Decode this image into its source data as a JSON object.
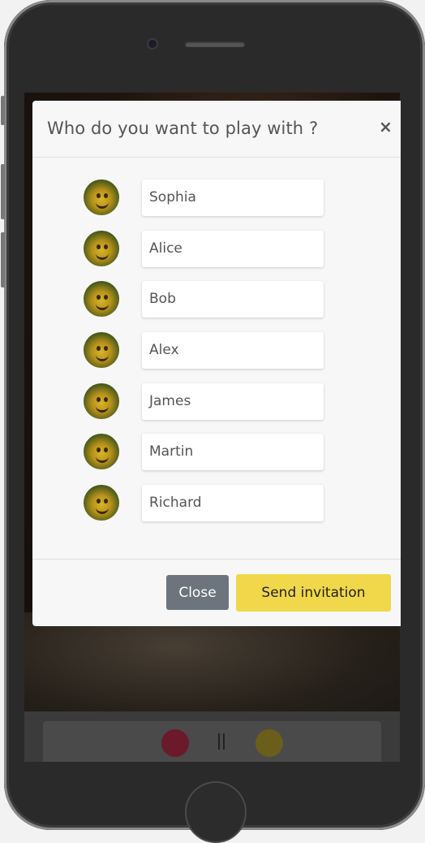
{
  "modal": {
    "title": "Who do you want to play with ?",
    "close_icon": "×",
    "players": [
      {
        "name": "Sophia"
      },
      {
        "name": "Alice"
      },
      {
        "name": "Bob"
      },
      {
        "name": "Alex"
      },
      {
        "name": "James"
      },
      {
        "name": "Martin"
      },
      {
        "name": "Richard"
      }
    ],
    "close_label": "Close",
    "send_label": "Send invitation"
  },
  "colors": {
    "send_button": "#f1d84a",
    "close_button": "#6c757d",
    "player_red": "#6a1a2a",
    "player_yellow": "#6b5e1a"
  },
  "bottom_bar": {
    "pause_icon": "pause-icon"
  }
}
